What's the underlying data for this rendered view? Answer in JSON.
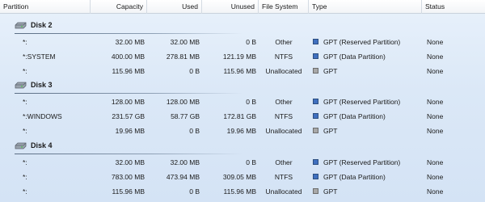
{
  "columns": [
    {
      "key": "partition",
      "label": "Partition"
    },
    {
      "key": "capacity",
      "label": "Capacity"
    },
    {
      "key": "used",
      "label": "Used"
    },
    {
      "key": "unused",
      "label": "Unused"
    },
    {
      "key": "fs",
      "label": "File System"
    },
    {
      "key": "type",
      "label": "Type"
    },
    {
      "key": "status",
      "label": "Status"
    }
  ],
  "disks": [
    {
      "name": "Disk 2",
      "partitions": [
        {
          "partition": "*:",
          "capacity": "32.00 MB",
          "used": "32.00 MB",
          "unused": "0 B",
          "fs": "Other",
          "type": "GPT (Reserved Partition)",
          "type_color": "#3f6fbf",
          "status": "None"
        },
        {
          "partition": "*:SYSTEM",
          "capacity": "400.00 MB",
          "used": "278.81 MB",
          "unused": "121.19 MB",
          "fs": "NTFS",
          "type": "GPT (Data Partition)",
          "type_color": "#3f6fbf",
          "status": "None"
        },
        {
          "partition": "*:",
          "capacity": "115.96 MB",
          "used": "0 B",
          "unused": "115.96 MB",
          "fs": "Unallocated",
          "type": "GPT",
          "type_color": "#a8a8a8",
          "status": "None"
        }
      ]
    },
    {
      "name": "Disk 3",
      "partitions": [
        {
          "partition": "*:",
          "capacity": "128.00 MB",
          "used": "128.00 MB",
          "unused": "0 B",
          "fs": "Other",
          "type": "GPT (Reserved Partition)",
          "type_color": "#3f6fbf",
          "status": "None"
        },
        {
          "partition": "*:WINDOWS",
          "capacity": "231.57 GB",
          "used": "58.77 GB",
          "unused": "172.81 GB",
          "fs": "NTFS",
          "type": "GPT (Data Partition)",
          "type_color": "#3f6fbf",
          "status": "None"
        },
        {
          "partition": "*:",
          "capacity": "19.96 MB",
          "used": "0 B",
          "unused": "19.96 MB",
          "fs": "Unallocated",
          "type": "GPT",
          "type_color": "#a8a8a8",
          "status": "None"
        }
      ]
    },
    {
      "name": "Disk 4",
      "partitions": [
        {
          "partition": "*:",
          "capacity": "32.00 MB",
          "used": "32.00 MB",
          "unused": "0 B",
          "fs": "Other",
          "type": "GPT (Reserved Partition)",
          "type_color": "#3f6fbf",
          "status": "None"
        },
        {
          "partition": "*:",
          "capacity": "783.00 MB",
          "used": "473.94 MB",
          "unused": "309.05 MB",
          "fs": "NTFS",
          "type": "GPT (Data Partition)",
          "type_color": "#3f6fbf",
          "status": "None"
        },
        {
          "partition": "*:",
          "capacity": "115.96 MB",
          "used": "0 B",
          "unused": "115.96 MB",
          "fs": "Unallocated",
          "type": "GPT",
          "type_color": "#a8a8a8",
          "status": "None"
        }
      ]
    }
  ],
  "icons": {
    "disk": "hard-disk-icon",
    "type_swatch": "partition-type-swatch-icon"
  }
}
